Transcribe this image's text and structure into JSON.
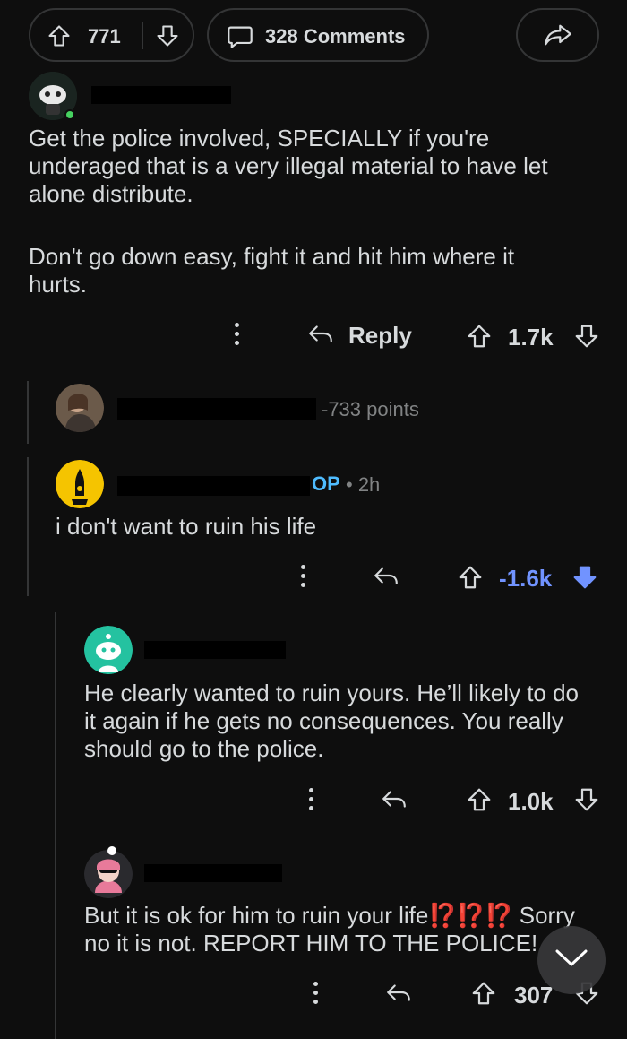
{
  "post_actions": {
    "vote_count": "771",
    "comments_label": "328 Comments"
  },
  "comments": [
    {
      "body_lines": [
        "Get the police involved, SPECIALLY if you're",
        "underaged that is a very illegal material to have let",
        "alone distribute.",
        "",
        "Don't go down easy, fight it and hit him where it",
        "hurts."
      ],
      "reply_label": "Reply",
      "score": "1.7k"
    },
    {
      "points": "-733 points"
    },
    {
      "op_badge": "OP",
      "time": "• 2h",
      "body": "i don't want to ruin his life",
      "score": "-1.6k"
    },
    {
      "body_lines": [
        "He clearly wanted to ruin yours. He’ll likely to do",
        "it again if he gets no consequences. You really",
        "should go to the police."
      ],
      "score": "1.0k"
    },
    {
      "body_line1_before": "But it is ok for him to ruin your life",
      "emphasis": "⁉️⁉️⁉️",
      "body_line1_after": " Sorry",
      "body_line2": "no it is not. REPORT HIM TO THE POLICE!",
      "score": "307"
    }
  ],
  "colors": {
    "background": "#0e0e0e",
    "text": "#d7dadc",
    "muted": "#818384",
    "downvoted": "#7193ff",
    "op_badge": "#4fbcff",
    "online": "#46d160",
    "emphasis": "#e0201b"
  },
  "icons": [
    "upvote-icon",
    "downvote-icon",
    "comment-icon",
    "share-icon",
    "reply-icon",
    "more-icon",
    "chevron-down-icon"
  ]
}
